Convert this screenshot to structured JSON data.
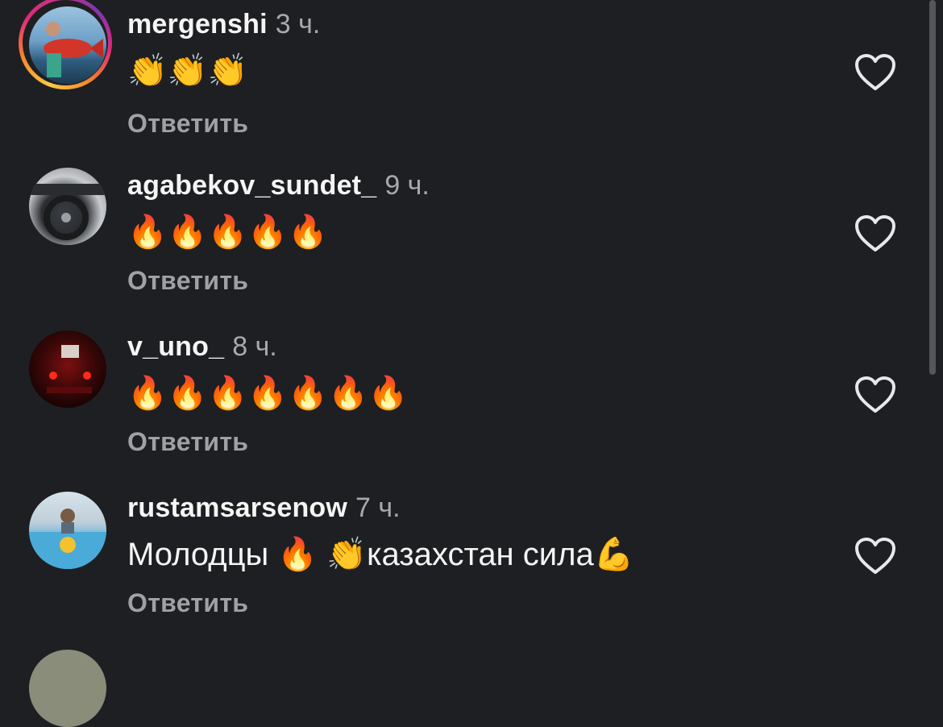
{
  "comments": [
    {
      "username": "mergenshi",
      "time": "3 ч.",
      "text": "👏👏👏",
      "reply": "Ответить",
      "has_story_ring": true
    },
    {
      "username": "agabekov_sundet_",
      "time": "9 ч.",
      "text": "🔥🔥🔥🔥🔥",
      "reply": "Ответить",
      "has_story_ring": false
    },
    {
      "username": "v_uno_",
      "time": "8 ч.",
      "text": "🔥🔥🔥🔥🔥🔥🔥",
      "reply": "Ответить",
      "has_story_ring": false
    },
    {
      "username": "rustamsarsenow",
      "time": "7 ч.",
      "text": "Молодцы 🔥 👏казахстан сила💪",
      "reply": "Ответить",
      "has_story_ring": false
    }
  ],
  "icons": {
    "like": "heart-outline-icon"
  },
  "colors": {
    "background": "#1e1f22",
    "username": "#f5f5f5",
    "meta": "#a8a8ad",
    "reply": "#a0a0a6"
  }
}
